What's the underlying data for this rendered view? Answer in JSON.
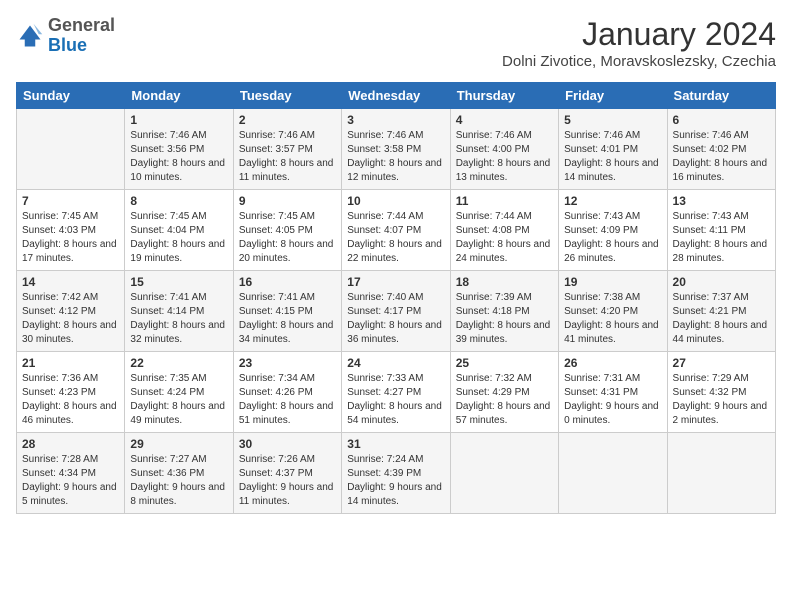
{
  "header": {
    "logo": {
      "general": "General",
      "blue": "Blue"
    },
    "title": "January 2024",
    "subtitle": "Dolni Zivotice, Moravskoslezsky, Czechia"
  },
  "weekdays": [
    "Sunday",
    "Monday",
    "Tuesday",
    "Wednesday",
    "Thursday",
    "Friday",
    "Saturday"
  ],
  "weeks": [
    [
      {
        "day": "",
        "sunrise": "",
        "sunset": "",
        "daylight": ""
      },
      {
        "day": "1",
        "sunrise": "Sunrise: 7:46 AM",
        "sunset": "Sunset: 3:56 PM",
        "daylight": "Daylight: 8 hours and 10 minutes."
      },
      {
        "day": "2",
        "sunrise": "Sunrise: 7:46 AM",
        "sunset": "Sunset: 3:57 PM",
        "daylight": "Daylight: 8 hours and 11 minutes."
      },
      {
        "day": "3",
        "sunrise": "Sunrise: 7:46 AM",
        "sunset": "Sunset: 3:58 PM",
        "daylight": "Daylight: 8 hours and 12 minutes."
      },
      {
        "day": "4",
        "sunrise": "Sunrise: 7:46 AM",
        "sunset": "Sunset: 4:00 PM",
        "daylight": "Daylight: 8 hours and 13 minutes."
      },
      {
        "day": "5",
        "sunrise": "Sunrise: 7:46 AM",
        "sunset": "Sunset: 4:01 PM",
        "daylight": "Daylight: 8 hours and 14 minutes."
      },
      {
        "day": "6",
        "sunrise": "Sunrise: 7:46 AM",
        "sunset": "Sunset: 4:02 PM",
        "daylight": "Daylight: 8 hours and 16 minutes."
      }
    ],
    [
      {
        "day": "7",
        "sunrise": "Sunrise: 7:45 AM",
        "sunset": "Sunset: 4:03 PM",
        "daylight": "Daylight: 8 hours and 17 minutes."
      },
      {
        "day": "8",
        "sunrise": "Sunrise: 7:45 AM",
        "sunset": "Sunset: 4:04 PM",
        "daylight": "Daylight: 8 hours and 19 minutes."
      },
      {
        "day": "9",
        "sunrise": "Sunrise: 7:45 AM",
        "sunset": "Sunset: 4:05 PM",
        "daylight": "Daylight: 8 hours and 20 minutes."
      },
      {
        "day": "10",
        "sunrise": "Sunrise: 7:44 AM",
        "sunset": "Sunset: 4:07 PM",
        "daylight": "Daylight: 8 hours and 22 minutes."
      },
      {
        "day": "11",
        "sunrise": "Sunrise: 7:44 AM",
        "sunset": "Sunset: 4:08 PM",
        "daylight": "Daylight: 8 hours and 24 minutes."
      },
      {
        "day": "12",
        "sunrise": "Sunrise: 7:43 AM",
        "sunset": "Sunset: 4:09 PM",
        "daylight": "Daylight: 8 hours and 26 minutes."
      },
      {
        "day": "13",
        "sunrise": "Sunrise: 7:43 AM",
        "sunset": "Sunset: 4:11 PM",
        "daylight": "Daylight: 8 hours and 28 minutes."
      }
    ],
    [
      {
        "day": "14",
        "sunrise": "Sunrise: 7:42 AM",
        "sunset": "Sunset: 4:12 PM",
        "daylight": "Daylight: 8 hours and 30 minutes."
      },
      {
        "day": "15",
        "sunrise": "Sunrise: 7:41 AM",
        "sunset": "Sunset: 4:14 PM",
        "daylight": "Daylight: 8 hours and 32 minutes."
      },
      {
        "day": "16",
        "sunrise": "Sunrise: 7:41 AM",
        "sunset": "Sunset: 4:15 PM",
        "daylight": "Daylight: 8 hours and 34 minutes."
      },
      {
        "day": "17",
        "sunrise": "Sunrise: 7:40 AM",
        "sunset": "Sunset: 4:17 PM",
        "daylight": "Daylight: 8 hours and 36 minutes."
      },
      {
        "day": "18",
        "sunrise": "Sunrise: 7:39 AM",
        "sunset": "Sunset: 4:18 PM",
        "daylight": "Daylight: 8 hours and 39 minutes."
      },
      {
        "day": "19",
        "sunrise": "Sunrise: 7:38 AM",
        "sunset": "Sunset: 4:20 PM",
        "daylight": "Daylight: 8 hours and 41 minutes."
      },
      {
        "day": "20",
        "sunrise": "Sunrise: 7:37 AM",
        "sunset": "Sunset: 4:21 PM",
        "daylight": "Daylight: 8 hours and 44 minutes."
      }
    ],
    [
      {
        "day": "21",
        "sunrise": "Sunrise: 7:36 AM",
        "sunset": "Sunset: 4:23 PM",
        "daylight": "Daylight: 8 hours and 46 minutes."
      },
      {
        "day": "22",
        "sunrise": "Sunrise: 7:35 AM",
        "sunset": "Sunset: 4:24 PM",
        "daylight": "Daylight: 8 hours and 49 minutes."
      },
      {
        "day": "23",
        "sunrise": "Sunrise: 7:34 AM",
        "sunset": "Sunset: 4:26 PM",
        "daylight": "Daylight: 8 hours and 51 minutes."
      },
      {
        "day": "24",
        "sunrise": "Sunrise: 7:33 AM",
        "sunset": "Sunset: 4:27 PM",
        "daylight": "Daylight: 8 hours and 54 minutes."
      },
      {
        "day": "25",
        "sunrise": "Sunrise: 7:32 AM",
        "sunset": "Sunset: 4:29 PM",
        "daylight": "Daylight: 8 hours and 57 minutes."
      },
      {
        "day": "26",
        "sunrise": "Sunrise: 7:31 AM",
        "sunset": "Sunset: 4:31 PM",
        "daylight": "Daylight: 9 hours and 0 minutes."
      },
      {
        "day": "27",
        "sunrise": "Sunrise: 7:29 AM",
        "sunset": "Sunset: 4:32 PM",
        "daylight": "Daylight: 9 hours and 2 minutes."
      }
    ],
    [
      {
        "day": "28",
        "sunrise": "Sunrise: 7:28 AM",
        "sunset": "Sunset: 4:34 PM",
        "daylight": "Daylight: 9 hours and 5 minutes."
      },
      {
        "day": "29",
        "sunrise": "Sunrise: 7:27 AM",
        "sunset": "Sunset: 4:36 PM",
        "daylight": "Daylight: 9 hours and 8 minutes."
      },
      {
        "day": "30",
        "sunrise": "Sunrise: 7:26 AM",
        "sunset": "Sunset: 4:37 PM",
        "daylight": "Daylight: 9 hours and 11 minutes."
      },
      {
        "day": "31",
        "sunrise": "Sunrise: 7:24 AM",
        "sunset": "Sunset: 4:39 PM",
        "daylight": "Daylight: 9 hours and 14 minutes."
      },
      {
        "day": "",
        "sunrise": "",
        "sunset": "",
        "daylight": ""
      },
      {
        "day": "",
        "sunrise": "",
        "sunset": "",
        "daylight": ""
      },
      {
        "day": "",
        "sunrise": "",
        "sunset": "",
        "daylight": ""
      }
    ]
  ]
}
